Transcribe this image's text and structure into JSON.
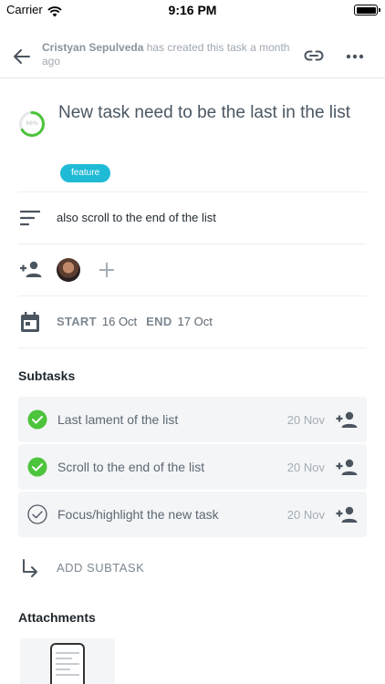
{
  "status_bar": {
    "carrier": "Carrier",
    "time": "9:16 PM"
  },
  "header": {
    "author": "Cristyan Sepulveda",
    "activity": " has created this task a month ago"
  },
  "task": {
    "progress_percent": 66,
    "progress_label": "66%",
    "title": "New task need to be the last in the list",
    "tag": "feature",
    "description": "also scroll to the end of the list"
  },
  "dates": {
    "start_label": "START",
    "start_value": "16 Oct",
    "end_label": "END",
    "end_value": "17 Oct"
  },
  "subtasks": {
    "title": "Subtasks",
    "items": [
      {
        "label": "Last lament of the list",
        "date": "20 Nov",
        "done": true
      },
      {
        "label": "Scroll to the end of the list",
        "date": "20 Nov",
        "done": true
      },
      {
        "label": "Focus/highlight the new task",
        "date": "20 Nov",
        "done": false
      }
    ],
    "add_label": "ADD SUBTASK"
  },
  "attachments": {
    "title": "Attachments"
  },
  "colors": {
    "accent_green": "#4cc43b",
    "tag_cyan": "#1fbad6",
    "icon_gray": "#4b5560"
  }
}
